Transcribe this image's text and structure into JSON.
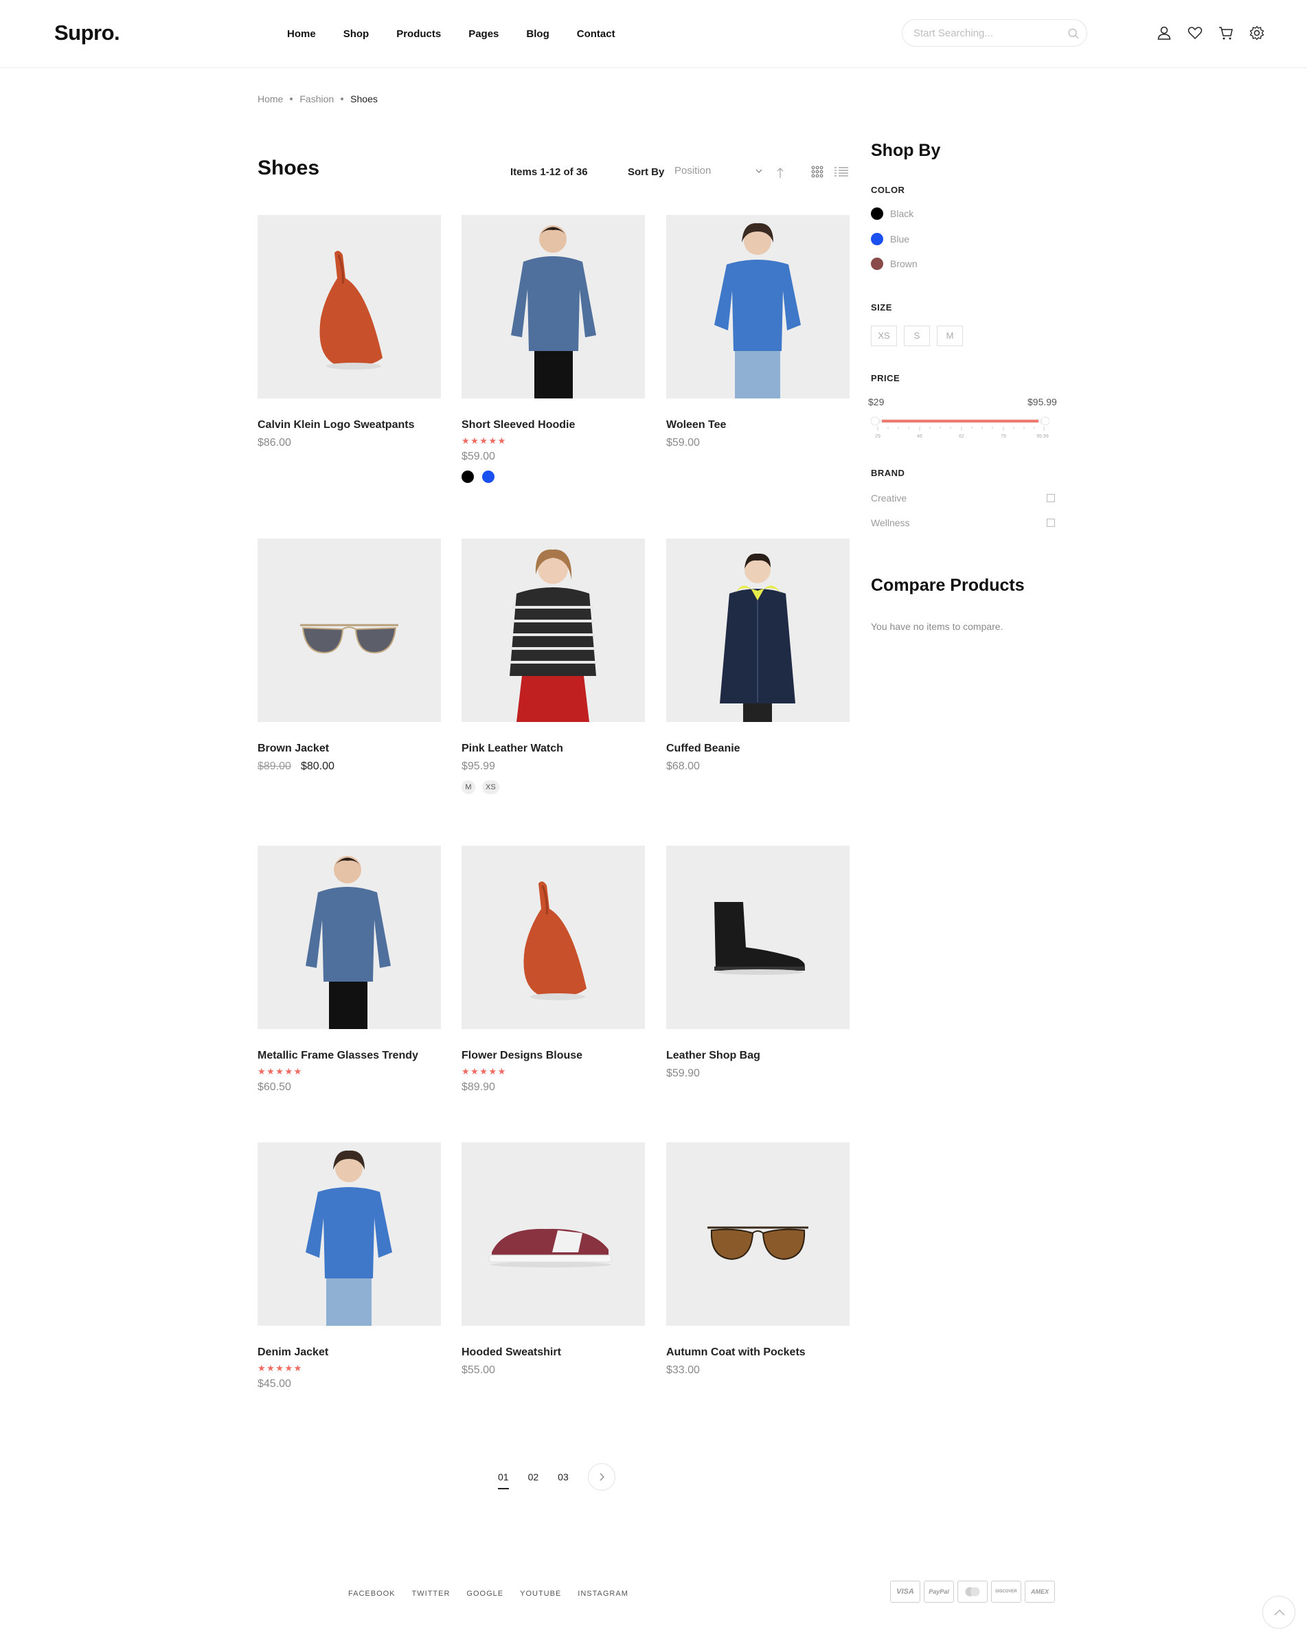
{
  "header": {
    "logo": "Supro.",
    "nav": [
      "Home",
      "Shop",
      "Products",
      "Pages",
      "Blog",
      "Contact"
    ],
    "search_placeholder": "Start Searching..."
  },
  "breadcrumb": [
    "Home",
    "Fashion",
    "Shoes"
  ],
  "toolbar": {
    "title": "Shoes",
    "items_count": "Items 1-12 of 36",
    "sort_label": "Sort By",
    "sort_value": "Position"
  },
  "products": [
    {
      "name": "Calvin Klein Logo Sweatpants",
      "price": "$86.00"
    },
    {
      "name": "Short Sleeved Hoodie",
      "stars": "★★★★★",
      "price": "$59.00",
      "swatches": [
        "#000000",
        "#1a4ff0"
      ]
    },
    {
      "name": "Woleen Tee",
      "price": "$59.00"
    },
    {
      "name": "Brown Jacket",
      "old_price": "$89.00",
      "price": "$80.00"
    },
    {
      "name": "Pink Leather Watch",
      "price": "$95.99",
      "sizes": [
        "M",
        "XS"
      ]
    },
    {
      "name": "Cuffed Beanie",
      "price": "$68.00"
    },
    {
      "name": "Metallic Frame Glasses Trendy",
      "stars": "★★★★★",
      "price": "$60.50"
    },
    {
      "name": "Flower Designs Blouse",
      "stars": "★★★★★",
      "price": "$89.90"
    },
    {
      "name": "Leather Shop Bag",
      "price": "$59.90"
    },
    {
      "name": "Denim Jacket",
      "stars": "★★★★★",
      "price": "$45.00"
    },
    {
      "name": "Hooded Sweatshirt",
      "price": "$55.00"
    },
    {
      "name": "Autumn Coat with Pockets",
      "price": "$33.00"
    }
  ],
  "pagination": [
    "01",
    "02",
    "03"
  ],
  "sidebar": {
    "title": "Shop By",
    "color_label": "COLOR",
    "colors": [
      {
        "name": "Black",
        "hex": "#000000"
      },
      {
        "name": "Blue",
        "hex": "#1a4ff0"
      },
      {
        "name": "Brown",
        "hex": "#8b4a4a"
      }
    ],
    "size_label": "SIZE",
    "sizes": [
      "XS",
      "S",
      "M"
    ],
    "price_label": "PRICE",
    "price_min": "$29",
    "price_max": "$95.99",
    "price_ticks": [
      "29",
      "46",
      "62",
      "79",
      "95.99"
    ],
    "brand_label": "BRAND",
    "brands": [
      "Creative",
      "Wellness"
    ],
    "compare_title": "Compare Products",
    "compare_text": "You have no items to compare."
  },
  "footer": {
    "social": [
      "FACEBOOK",
      "TWITTER",
      "GOOGLE",
      "YOUTUBE",
      "INSTAGRAM"
    ],
    "payments": [
      "VISA",
      "PayPal",
      "",
      "DISCOVER",
      "AMEX"
    ]
  },
  "colors": {
    "accent": "#ef6a60",
    "text": "#222222",
    "muted": "#8a8a8a"
  }
}
